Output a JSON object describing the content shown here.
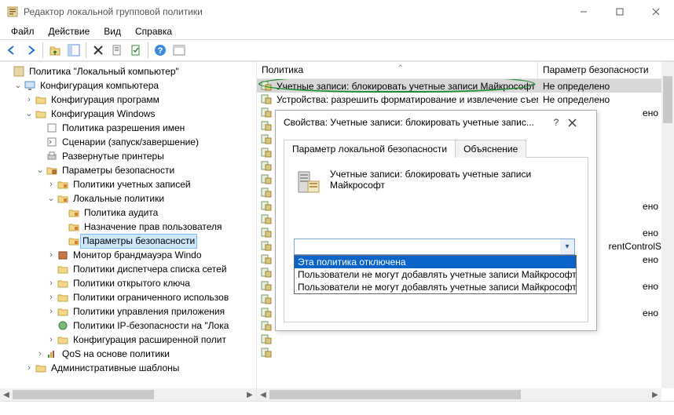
{
  "window": {
    "title": "Редактор локальной групповой политики"
  },
  "menu": {
    "file": "Файл",
    "action": "Действие",
    "view": "Вид",
    "help": "Справка"
  },
  "tree": {
    "root": "Политика \"Локальный компьютер\"",
    "computer_config": "Конфигурация компьютера",
    "software_settings": "Конфигурация программ",
    "windows_settings": "Конфигурация Windows",
    "name_resolution": "Политика разрешения имен",
    "scripts": "Сценарии (запуск/завершение)",
    "deployed_printers": "Развернутые принтеры",
    "security_settings": "Параметры безопасности",
    "account_policies": "Политики учетных записей",
    "local_policies": "Локальные политики",
    "audit_policy": "Политика аудита",
    "user_rights": "Назначение прав пользователя",
    "security_options": "Параметры безопасности",
    "firewall_monitor": "Монитор брандмауэра Windo",
    "nlm_policies": "Политики диспетчера списка сетей",
    "public_key": "Политики открытого ключа",
    "restricted_software": "Политики ограниченного использов",
    "app_control": "Политики управления приложения",
    "ipsec": "Политики IP-безопасности на \"Лока",
    "advanced_audit": "Конфигурация расширенной полит",
    "qos": "QoS на основе политики",
    "admin_templates": "Административные шаблоны"
  },
  "list": {
    "col_policy": "Политика",
    "col_security": "Параметр безопасности",
    "rows": [
      {
        "name": "Учетные записи: блокировать учетные записи Майкрософт",
        "value": "Не определено"
      },
      {
        "name": "Устройства: разрешить форматирование и извлечение съем...",
        "value": "Не определено"
      }
    ],
    "val_undefined": "ено",
    "val_controlset": "rentControlS..."
  },
  "dialog": {
    "title": "Свойства: Учетные записи: блокировать учетные запис...",
    "tab_local": "Параметр локальной безопасности",
    "tab_explain": "Объяснение",
    "heading": "Учетные записи: блокировать учетные записи Майкрософт",
    "options": [
      "Эта политика отключена",
      "Пользователи не могут добавлять учетные записи Майкрософт",
      "Пользователи не могут добавлять учетные записи Майкрософт и исп"
    ]
  }
}
